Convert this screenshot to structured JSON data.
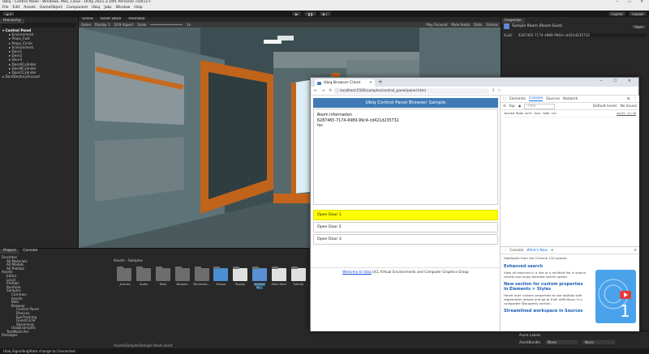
{
  "window": {
    "title": "Ubiq - Control Panel - Windows, Mac, Linux - Unity 2021.3.19f1 Personal <DX11>"
  },
  "menu": [
    "File",
    "Edit",
    "Assets",
    "GameObject",
    "Component",
    "Ubiq",
    "Jobs",
    "Window",
    "Help"
  ],
  "toolbar": {
    "layers": "Layers",
    "layout": "Layout"
  },
  "hierarchy": {
    "tab": "Hierarchy",
    "items": [
      "Control Panel",
      "Environment",
      "Props_Fwd",
      "Props_Circle",
      "Environment",
      "Door1",
      "Door2",
      "Door3",
      "DoorACylinder",
      "DoorBCylinder",
      "DoorCCylinder",
      "DontDestroyOnLoad"
    ]
  },
  "scene": {
    "tabs": [
      "Scene",
      "Asset Store",
      "Animator"
    ],
    "game_tab": "Game",
    "display": "Display 1",
    "aspect": "16:9 Aspect",
    "scale_label": "Scale",
    "scale_value": "1x",
    "play_focused": "Play Focused",
    "mute": "Mute Audio",
    "stats": "Stats",
    "gizmos": "Gizmos"
  },
  "inspector": {
    "tab": "Inspector",
    "object": "Sample Room (Room Guid)",
    "open": "Open",
    "fields": [
      {
        "label": "Guid",
        "value": "6287465-7174-4989-9904-cd421d235732"
      }
    ]
  },
  "project": {
    "tabs": [
      "Project",
      "Console"
    ],
    "tree": [
      "Favorites",
      "All Materials",
      "All Models",
      "All Prefabs",
      "Assets",
      "Editor",
      "Local",
      "Prefabs",
      "Runtime",
      "Samples",
      "Common",
      "Assets",
      "Bots",
      "Browser",
      "Control Panel",
      "Devices",
      "EyeTracking",
      "Guestcircle",
      "Streaming",
      "UbiqExamples",
      "TextMesh Pro",
      "Packages"
    ],
    "breadcrumb": [
      "Assets",
      "Samples"
    ],
    "assets": [
      "_Scenes",
      "Audio",
      "Bots",
      "Browser",
      "Minimalis...",
      "Mouse",
      "Replay",
      "Sample Ro...",
      "Start Here",
      "Tutorial"
    ],
    "path": "Assets/Samples/Sample Room.asset"
  },
  "status": {
    "text": "Ubiq SignallingState change to Connected"
  },
  "browser": {
    "tab_title": "Ubiq Browser Client Sample",
    "url": "localhost:5500/samples/control_panel/panel.html",
    "header": "Ubiq Control Panel Browser Sample",
    "room": {
      "heading": "Room information",
      "guid": "6287465-7174-4989-99c4-cd421d235732",
      "name": "tsc"
    },
    "doors": [
      "Open Door 1",
      "Open Door 2",
      "Open Door 3"
    ],
    "footer_link": "Welcome to Ubiq",
    "footer_text": "UCL Virtual Environments and Computer Graphics Group"
  },
  "devtools": {
    "tabs": [
      "Elements",
      "Console",
      "Sources",
      "Network"
    ],
    "top": "top",
    "filter_placeholder": "Filter",
    "levels": "Default levels",
    "issues": "No Issues",
    "log": "Joined Room with Join Code tsc",
    "log_source": "panel.js:48",
    "drawer_tabs": [
      "Console",
      "What's New"
    ],
    "highlights": "Highlights from the Chrome 110 update",
    "items": [
      {
        "title": "Enhanced search",
        "body": "View all matches in a line of a minified file in search results and enjoy blended search speed."
      },
      {
        "title": "New section for custom properties in Elements > Styles",
        "body": "Hover over custom properties to see tooltips with registration details and go to their definitions in a collapsible @property section."
      },
      {
        "title": "Streamlined workspace in Sources",
        "body": ""
      }
    ]
  },
  "asset_labels": {
    "title": "Asset Labels",
    "bundle": "AssetBundle",
    "none": "None"
  }
}
